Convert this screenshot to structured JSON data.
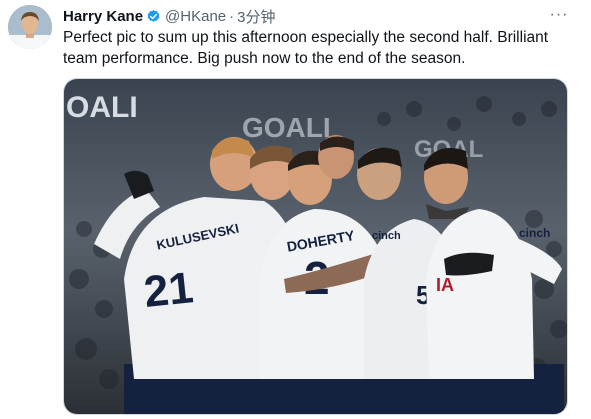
{
  "tweet": {
    "display_name": "Harry Kane",
    "handle": "@HKane",
    "separator": "·",
    "time": "3分钟",
    "text": "Perfect pic to sum up this afternoon especially the second half. Brilliant team performance. Big push now to the end of the season.",
    "more_glyph": "···"
  },
  "photo": {
    "stand_signs": [
      "OALI",
      "GOALI",
      "GOAL"
    ],
    "shirt_text": {
      "left_name": "KULUSEVSKI",
      "left_number": "21",
      "center_name": "DOHERTY",
      "center_number": "2",
      "right_sponsor": "cinch",
      "right_sponsor_2": "cinch",
      "right_number": "5",
      "right_partial": "IA"
    }
  },
  "colors": {
    "verified": "#1d9bf0",
    "secondary_text": "#536471",
    "kit_white": "#f2f3f5",
    "kit_navy": "#132257"
  },
  "icons": {
    "verified": "verified-badge-icon",
    "more": "more-options-icon"
  }
}
